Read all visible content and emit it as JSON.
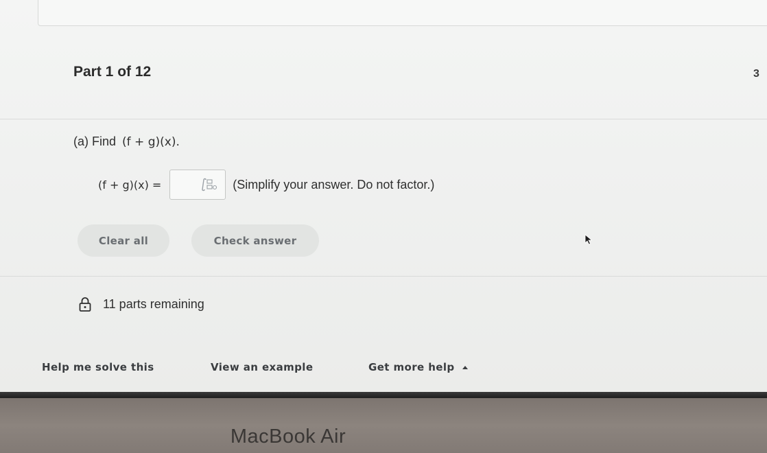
{
  "header": {
    "part_label": "Part 1 of 12",
    "score_fragment": "3"
  },
  "question": {
    "prompt_text": "(a) Find",
    "prompt_math": "(f + g)(x).",
    "answer_lhs": "(f + g)(x) =",
    "answer_value": "",
    "instructions": "(Simplify your answer. Do not factor.)"
  },
  "actions": {
    "clear_label": "Clear all",
    "check_label": "Check answer"
  },
  "status": {
    "remaining_text": "11 parts remaining"
  },
  "help": {
    "solve_label": "Help me solve this",
    "example_label": "View an example",
    "more_label": "Get more help"
  },
  "device": {
    "brand": "MacBook Air"
  },
  "icons": {
    "answer_box": "math-palette-icon",
    "status": "lock-icon",
    "more_help": "caret-up-icon",
    "pointer": "cursor-icon"
  },
  "colors": {
    "button_bg": "#e2e4e2",
    "button_text": "#6a6e72",
    "body_text": "#2f2f2f"
  }
}
